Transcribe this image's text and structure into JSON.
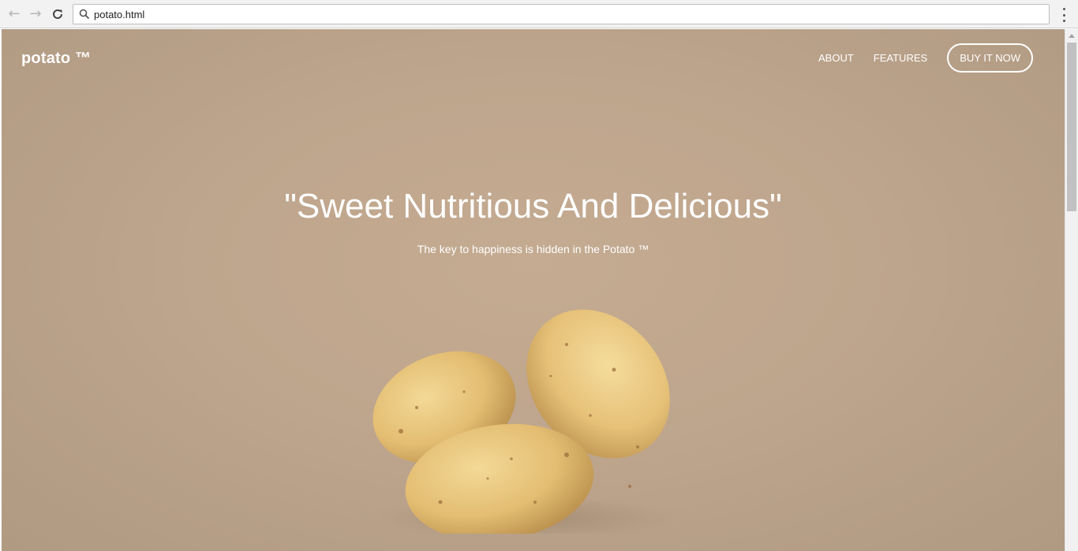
{
  "browser": {
    "address": "potato.html",
    "back_icon": "arrow-left-icon",
    "forward_icon": "arrow-right-icon",
    "reload_icon": "reload-icon",
    "search_icon": "search-icon",
    "menu_icon": "kebab-menu-icon"
  },
  "page": {
    "brand": "potato ™",
    "nav": {
      "about": "ABOUT",
      "features": "FEATURES",
      "buy": "BUY IT NOW"
    },
    "hero": {
      "title": "\"Sweet Nutritious And Delicious\"",
      "subtitle": "The key to happiness is hidden in the Potato ™"
    },
    "colors": {
      "background": "#bea58d",
      "text": "#ffffff",
      "potato": "#e8c47a"
    }
  }
}
